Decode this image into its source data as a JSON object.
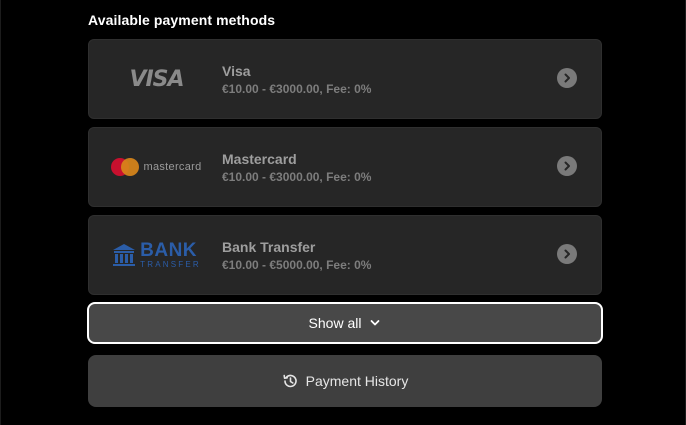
{
  "section": {
    "title": "Available payment methods"
  },
  "methods": [
    {
      "name": "Visa",
      "range": "€10.00 - €3000.00, Fee: 0%",
      "logo_text": "VISA",
      "icon": "visa-logo"
    },
    {
      "name": "Mastercard",
      "range": "€10.00 - €3000.00, Fee: 0%",
      "logo_text": "mastercard",
      "icon": "mastercard-logo"
    },
    {
      "name": "Bank Transfer",
      "range": "€10.00 - €5000.00, Fee: 0%",
      "logo_text": "BANK",
      "logo_subtext": "TRANSFER",
      "icon": "bank-transfer-logo"
    }
  ],
  "show_all": {
    "label": "Show all",
    "icon": "chevron-down-icon"
  },
  "history": {
    "label": "Payment History",
    "icon": "history-icon"
  },
  "colors": {
    "background": "#000000",
    "card": "#262626",
    "mastercard_red": "#c8102e",
    "mastercard_orange": "#d8861a",
    "bank_blue": "#2b5da8"
  }
}
